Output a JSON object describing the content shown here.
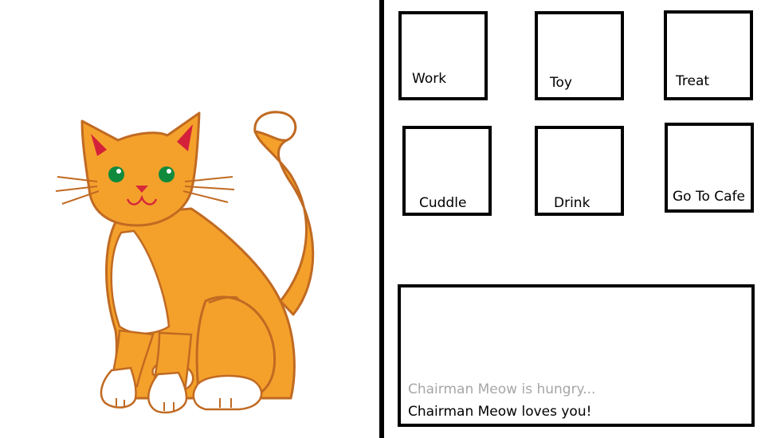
{
  "pet": {
    "illustration": "orange-tabby-cat-sitting",
    "colors": {
      "fur": "#f4a12c",
      "outline": "#c06a22",
      "belly": "#ffffff",
      "eyes": "#0f8a3c",
      "nose": "#d62a3a",
      "inner_ear": "#d4213a"
    }
  },
  "actions": [
    {
      "id": "work",
      "label": "Work"
    },
    {
      "id": "toy",
      "label": "Toy"
    },
    {
      "id": "treat",
      "label": "Treat"
    },
    {
      "id": "cuddle",
      "label": "Cuddle"
    },
    {
      "id": "drink",
      "label": "Drink"
    },
    {
      "id": "go-to-cafe",
      "label": "Go To Cafe"
    }
  ],
  "log": {
    "previous": "Chairman Meow is hungry...",
    "latest": "Chairman Meow loves you!"
  }
}
